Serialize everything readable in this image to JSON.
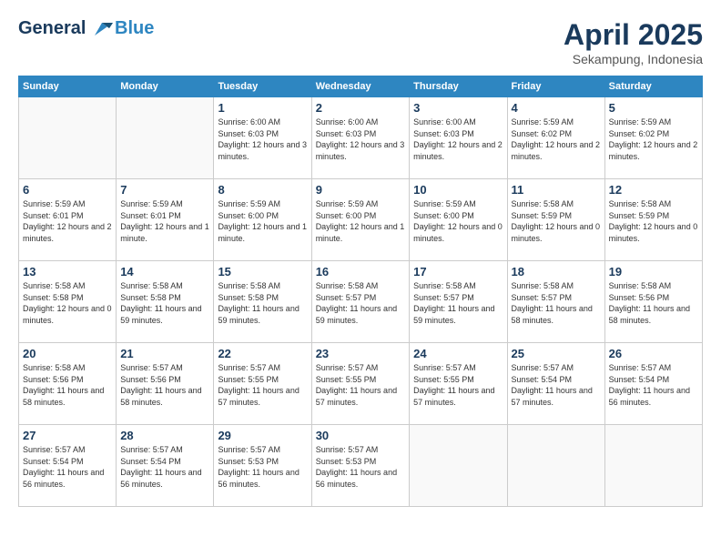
{
  "header": {
    "logo_line1": "General",
    "logo_line2": "Blue",
    "month": "April 2025",
    "location": "Sekampung, Indonesia"
  },
  "days_of_week": [
    "Sunday",
    "Monday",
    "Tuesday",
    "Wednesday",
    "Thursday",
    "Friday",
    "Saturday"
  ],
  "weeks": [
    [
      {
        "day": "",
        "sunrise": "",
        "sunset": "",
        "daylight": ""
      },
      {
        "day": "",
        "sunrise": "",
        "sunset": "",
        "daylight": ""
      },
      {
        "day": "1",
        "sunrise": "Sunrise: 6:00 AM",
        "sunset": "Sunset: 6:03 PM",
        "daylight": "Daylight: 12 hours and 3 minutes."
      },
      {
        "day": "2",
        "sunrise": "Sunrise: 6:00 AM",
        "sunset": "Sunset: 6:03 PM",
        "daylight": "Daylight: 12 hours and 3 minutes."
      },
      {
        "day": "3",
        "sunrise": "Sunrise: 6:00 AM",
        "sunset": "Sunset: 6:03 PM",
        "daylight": "Daylight: 12 hours and 2 minutes."
      },
      {
        "day": "4",
        "sunrise": "Sunrise: 5:59 AM",
        "sunset": "Sunset: 6:02 PM",
        "daylight": "Daylight: 12 hours and 2 minutes."
      },
      {
        "day": "5",
        "sunrise": "Sunrise: 5:59 AM",
        "sunset": "Sunset: 6:02 PM",
        "daylight": "Daylight: 12 hours and 2 minutes."
      }
    ],
    [
      {
        "day": "6",
        "sunrise": "Sunrise: 5:59 AM",
        "sunset": "Sunset: 6:01 PM",
        "daylight": "Daylight: 12 hours and 2 minutes."
      },
      {
        "day": "7",
        "sunrise": "Sunrise: 5:59 AM",
        "sunset": "Sunset: 6:01 PM",
        "daylight": "Daylight: 12 hours and 1 minute."
      },
      {
        "day": "8",
        "sunrise": "Sunrise: 5:59 AM",
        "sunset": "Sunset: 6:00 PM",
        "daylight": "Daylight: 12 hours and 1 minute."
      },
      {
        "day": "9",
        "sunrise": "Sunrise: 5:59 AM",
        "sunset": "Sunset: 6:00 PM",
        "daylight": "Daylight: 12 hours and 1 minute."
      },
      {
        "day": "10",
        "sunrise": "Sunrise: 5:59 AM",
        "sunset": "Sunset: 6:00 PM",
        "daylight": "Daylight: 12 hours and 0 minutes."
      },
      {
        "day": "11",
        "sunrise": "Sunrise: 5:58 AM",
        "sunset": "Sunset: 5:59 PM",
        "daylight": "Daylight: 12 hours and 0 minutes."
      },
      {
        "day": "12",
        "sunrise": "Sunrise: 5:58 AM",
        "sunset": "Sunset: 5:59 PM",
        "daylight": "Daylight: 12 hours and 0 minutes."
      }
    ],
    [
      {
        "day": "13",
        "sunrise": "Sunrise: 5:58 AM",
        "sunset": "Sunset: 5:58 PM",
        "daylight": "Daylight: 12 hours and 0 minutes."
      },
      {
        "day": "14",
        "sunrise": "Sunrise: 5:58 AM",
        "sunset": "Sunset: 5:58 PM",
        "daylight": "Daylight: 11 hours and 59 minutes."
      },
      {
        "day": "15",
        "sunrise": "Sunrise: 5:58 AM",
        "sunset": "Sunset: 5:58 PM",
        "daylight": "Daylight: 11 hours and 59 minutes."
      },
      {
        "day": "16",
        "sunrise": "Sunrise: 5:58 AM",
        "sunset": "Sunset: 5:57 PM",
        "daylight": "Daylight: 11 hours and 59 minutes."
      },
      {
        "day": "17",
        "sunrise": "Sunrise: 5:58 AM",
        "sunset": "Sunset: 5:57 PM",
        "daylight": "Daylight: 11 hours and 59 minutes."
      },
      {
        "day": "18",
        "sunrise": "Sunrise: 5:58 AM",
        "sunset": "Sunset: 5:57 PM",
        "daylight": "Daylight: 11 hours and 58 minutes."
      },
      {
        "day": "19",
        "sunrise": "Sunrise: 5:58 AM",
        "sunset": "Sunset: 5:56 PM",
        "daylight": "Daylight: 11 hours and 58 minutes."
      }
    ],
    [
      {
        "day": "20",
        "sunrise": "Sunrise: 5:58 AM",
        "sunset": "Sunset: 5:56 PM",
        "daylight": "Daylight: 11 hours and 58 minutes."
      },
      {
        "day": "21",
        "sunrise": "Sunrise: 5:57 AM",
        "sunset": "Sunset: 5:56 PM",
        "daylight": "Daylight: 11 hours and 58 minutes."
      },
      {
        "day": "22",
        "sunrise": "Sunrise: 5:57 AM",
        "sunset": "Sunset: 5:55 PM",
        "daylight": "Daylight: 11 hours and 57 minutes."
      },
      {
        "day": "23",
        "sunrise": "Sunrise: 5:57 AM",
        "sunset": "Sunset: 5:55 PM",
        "daylight": "Daylight: 11 hours and 57 minutes."
      },
      {
        "day": "24",
        "sunrise": "Sunrise: 5:57 AM",
        "sunset": "Sunset: 5:55 PM",
        "daylight": "Daylight: 11 hours and 57 minutes."
      },
      {
        "day": "25",
        "sunrise": "Sunrise: 5:57 AM",
        "sunset": "Sunset: 5:54 PM",
        "daylight": "Daylight: 11 hours and 57 minutes."
      },
      {
        "day": "26",
        "sunrise": "Sunrise: 5:57 AM",
        "sunset": "Sunset: 5:54 PM",
        "daylight": "Daylight: 11 hours and 56 minutes."
      }
    ],
    [
      {
        "day": "27",
        "sunrise": "Sunrise: 5:57 AM",
        "sunset": "Sunset: 5:54 PM",
        "daylight": "Daylight: 11 hours and 56 minutes."
      },
      {
        "day": "28",
        "sunrise": "Sunrise: 5:57 AM",
        "sunset": "Sunset: 5:54 PM",
        "daylight": "Daylight: 11 hours and 56 minutes."
      },
      {
        "day": "29",
        "sunrise": "Sunrise: 5:57 AM",
        "sunset": "Sunset: 5:53 PM",
        "daylight": "Daylight: 11 hours and 56 minutes."
      },
      {
        "day": "30",
        "sunrise": "Sunrise: 5:57 AM",
        "sunset": "Sunset: 5:53 PM",
        "daylight": "Daylight: 11 hours and 56 minutes."
      },
      {
        "day": "",
        "sunrise": "",
        "sunset": "",
        "daylight": ""
      },
      {
        "day": "",
        "sunrise": "",
        "sunset": "",
        "daylight": ""
      },
      {
        "day": "",
        "sunrise": "",
        "sunset": "",
        "daylight": ""
      }
    ]
  ]
}
